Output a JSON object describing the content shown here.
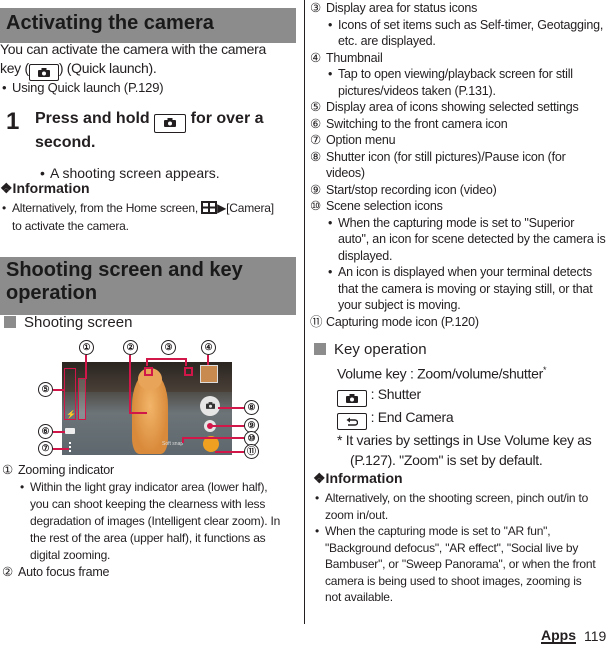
{
  "left": {
    "section1_title": "Activating the camera",
    "intro_line1": "You can activate the camera with the camera",
    "intro_line2_pre": "key (",
    "intro_line2_post": ") (Quick launch).",
    "intro_bullet": "Using Quick launch (P.129)",
    "step_number": "1",
    "step_line1_pre": "Press and hold",
    "step_line1_post": "for over a",
    "step_line2": "second.",
    "step_bullet": "A shooting screen appears.",
    "info_title": "❖Information",
    "info_bullet_pre": "Alternatively, from the Home screen,",
    "info_bullet_arrow": "▶",
    "info_bullet_post": "[Camera]",
    "info_bullet_line2": "to activate the camera.",
    "section2_title_line1": "Shooting screen and key",
    "section2_title_line2": "operation",
    "subsection_title": "Shooting screen",
    "callouts": [
      "①",
      "②",
      "③",
      "④",
      "⑤",
      "⑥",
      "⑦",
      "⑧",
      "⑨",
      "⑩",
      "⑪"
    ],
    "scene_text": "Soft snap",
    "items": [
      {
        "num": "①",
        "label": "Zooming indicator",
        "bullet_lines": [
          "Within the light gray indicator area (lower half),",
          "you can shoot keeping the clearness with less",
          "degradation of images (Intelligent clear zoom). In",
          "the rest of the area (upper half), it functions as",
          "digital zooming."
        ]
      },
      {
        "num": "②",
        "label": "Auto focus frame"
      }
    ]
  },
  "right": {
    "items": [
      {
        "num": "③",
        "label": "Display area for status icons",
        "bullet_lines": [
          "Icons of set items such as Self-timer, Geotagging,",
          "etc. are displayed."
        ]
      },
      {
        "num": "④",
        "label": "Thumbnail",
        "bullet_lines": [
          "Tap to open viewing/playback screen for still",
          "pictures/videos taken (P.131)."
        ]
      },
      {
        "num": "⑤",
        "label": "Display area of icons showing selected settings"
      },
      {
        "num": "⑥",
        "label": "Switching to the front camera icon"
      },
      {
        "num": "⑦",
        "label": "Option menu"
      },
      {
        "num": "⑧",
        "label": "Shutter icon (for still pictures)/Pause icon (for",
        "label2": "videos)"
      },
      {
        "num": "⑨",
        "label": "Start/stop recording icon (video)"
      },
      {
        "num": "⑩",
        "label": "Scene selection icons",
        "bullets": [
          [
            "When the capturing mode is set to \"Superior",
            "auto\", an icon for scene detected by the camera is",
            "displayed."
          ],
          [
            "An icon is displayed when your terminal detects",
            "that the camera is moving or staying still, or that",
            "your subject is moving."
          ]
        ]
      },
      {
        "num": "⑪",
        "label": "Capturing mode icon (P.120)"
      }
    ],
    "key_title": "Key operation",
    "volume_line": "Volume key : Zoom/volume/shutter",
    "asterisk": "*",
    "shutter_label": ": Shutter",
    "end_label": ": End Camera",
    "note_line1": "*  It varies by settings in Use Volume key as",
    "note_line2": "(P.127). \"Zoom\" is set by default.",
    "info_title": "❖Information",
    "info_bullets": [
      [
        "Alternatively, on the shooting screen, pinch out/in to",
        "zoom in/out."
      ],
      [
        "When the capturing mode is set to \"AR fun\",",
        "\"Background defocus\", \"AR effect\", \"Social live by",
        "Bambuser\", or \"Sweep Panorama\", or when the front",
        "camera is being used to shoot images, zooming is",
        "not available."
      ]
    ]
  },
  "footer": {
    "section": "Apps",
    "page": "119"
  },
  "colors": {
    "section_bar": "#8c8c8c",
    "callout_red": "#d1174a",
    "capture_mode_orange": "#f0a020"
  }
}
